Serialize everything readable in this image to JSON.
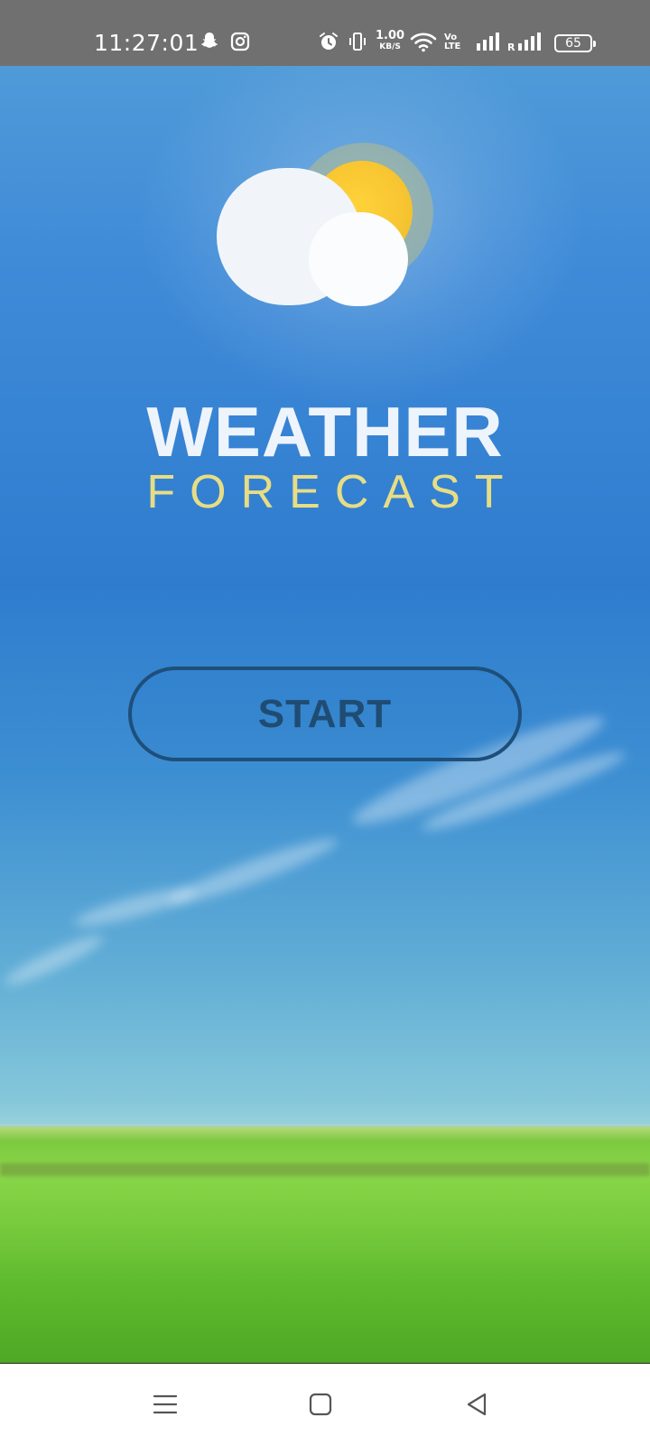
{
  "status_bar": {
    "time": "11:27:01",
    "net_speed_value": "1.00",
    "net_speed_unit": "KB/S",
    "volte_line1": "Vo",
    "volte_line2": "LTE",
    "battery_level": "65",
    "icons": [
      "snapchat-icon",
      "instagram-icon",
      "alarm-icon",
      "vibrate-icon",
      "wifi-icon",
      "signal-icon",
      "signal-roaming-icon",
      "battery-icon"
    ]
  },
  "app": {
    "title_line1": "WEATHER",
    "title_line2": "FORECAST",
    "start_label": "START",
    "logo_icon": "sun-cloud-icon"
  },
  "nav_bar": {
    "items": [
      "menu-icon",
      "home-icon",
      "back-icon"
    ]
  },
  "colors": {
    "title_white": "#eef4fb",
    "title_gold": "#e7dd85",
    "button_border": "#1e4f7a",
    "sky_blue": "#2f7ccf",
    "grass_green": "#78cc3d"
  }
}
